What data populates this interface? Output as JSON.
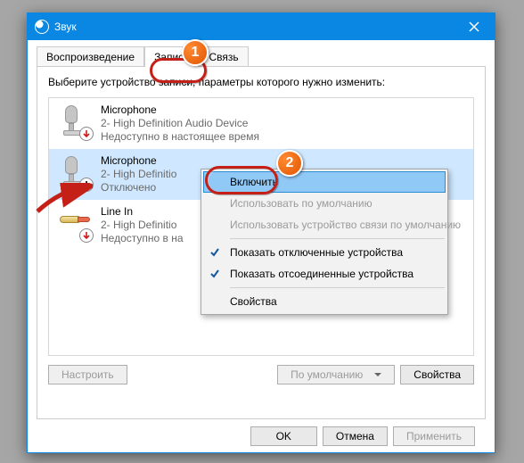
{
  "window": {
    "title": "Звук"
  },
  "tabs": {
    "items": [
      {
        "label": "Воспроизведение"
      },
      {
        "label": "Запись"
      },
      {
        "label": "Связь"
      }
    ],
    "active_index": 1
  },
  "instruction": "Выберите устройство записи, параметры которого нужно изменить:",
  "devices": [
    {
      "name": "Microphone",
      "subtitle": "2- High Definition Audio Device",
      "status": "Недоступно в настоящее время",
      "icon": "microphone",
      "badge": "down-red",
      "selected": false
    },
    {
      "name": "Microphone",
      "subtitle": "2- High Definitio",
      "status": "Отключено",
      "icon": "microphone",
      "badge": "down-black",
      "selected": true
    },
    {
      "name": "Line In",
      "subtitle": "2- High Definitio",
      "status": "Недоступно в на",
      "icon": "linein",
      "badge": "down-red",
      "selected": false
    }
  ],
  "buttons": {
    "configure": "Настроить",
    "default": "По умолчанию",
    "properties": "Свойства",
    "ok": "OK",
    "cancel": "Отмена",
    "apply": "Применить"
  },
  "context_menu": {
    "enable": "Включить",
    "use_default": "Использовать по умолчанию",
    "use_comm_default": "Использовать устройство связи по умолчанию",
    "show_disabled": "Показать отключенные устройства",
    "show_disconnected": "Показать отсоединенные устройства",
    "properties": "Свойства"
  },
  "annotations": {
    "n1": "1",
    "n2": "2"
  }
}
